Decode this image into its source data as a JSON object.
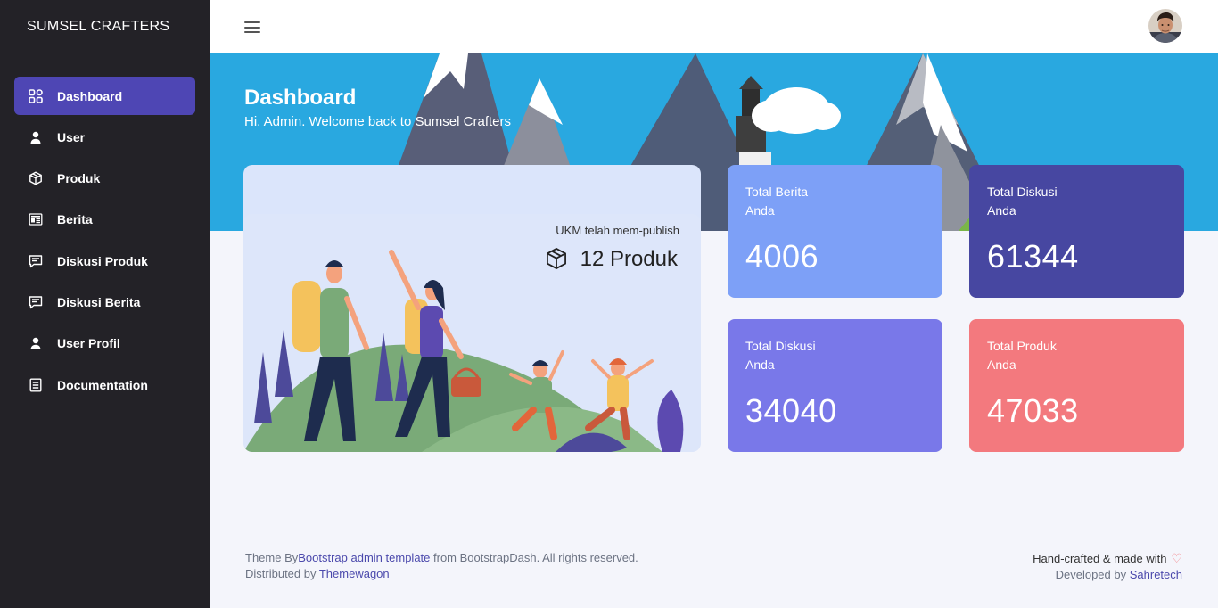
{
  "brand": "SUMSEL CRAFTERS",
  "sidebar": {
    "items": [
      {
        "label": "Dashboard",
        "icon": "grid-icon",
        "active": true
      },
      {
        "label": "User",
        "icon": "user-icon"
      },
      {
        "label": "Produk",
        "icon": "box-icon"
      },
      {
        "label": "Berita",
        "icon": "newspaper-icon"
      },
      {
        "label": "Diskusi Produk",
        "icon": "chat-icon"
      },
      {
        "label": "Diskusi Berita",
        "icon": "chat-icon"
      },
      {
        "label": "User Profil",
        "icon": "user-icon"
      },
      {
        "label": "Documentation",
        "icon": "document-icon"
      }
    ]
  },
  "header": {
    "title": "Dashboard",
    "welcome": "Hi, Admin. Welcome back to Sumsel Crafters"
  },
  "illustration_card": {
    "caption": "UKM telah mem-publish",
    "count_label": "12 Produk"
  },
  "stats": [
    {
      "label_line1": "Total Berita",
      "label_line2": "Anda",
      "value": "4006",
      "color": "#7da0f7"
    },
    {
      "label_line1": "Total Diskusi",
      "label_line2": "Anda",
      "value": "61344",
      "color": "#4747a1"
    },
    {
      "label_line1": "Total Diskusi",
      "label_line2": "Anda",
      "value": "34040",
      "color": "#7978e9"
    },
    {
      "label_line1": "Total Produk",
      "label_line2": "Anda",
      "value": "47033",
      "color": "#f3797e"
    }
  ],
  "footer": {
    "theme_prefix": "Theme By",
    "theme_link": "Bootstrap admin template",
    "theme_suffix": " from BootstrapDash. All rights reserved.",
    "distributed_prefix": "Distributed by ",
    "distributed_link": "Themewagon",
    "handcrafted": "Hand-crafted & made with",
    "developed_prefix": "Developed by ",
    "developed_link": "Sahretech"
  },
  "colors": {
    "sidebar_bg": "#232227",
    "active_item": "#4e46b4",
    "hero_sky": "#29a8e0",
    "accent_link": "#4b49ac"
  }
}
